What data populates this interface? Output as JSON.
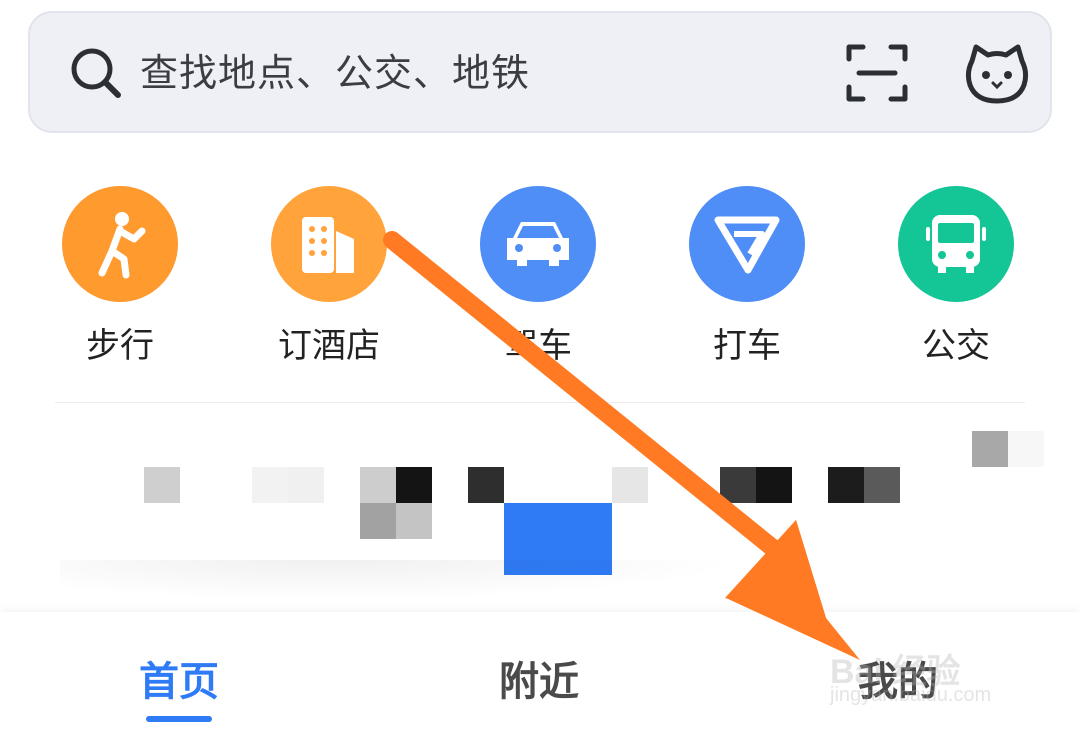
{
  "search": {
    "placeholder": "查找地点、公交、地铁",
    "icons": [
      "search-icon",
      "scan-icon",
      "mascot-icon"
    ]
  },
  "shortcuts": [
    {
      "label": "步行",
      "icon": "walking-person-icon",
      "color": "#ff9a2e"
    },
    {
      "label": "订酒店",
      "icon": "hotel-building-icon",
      "color": "#ffa33a"
    },
    {
      "label": "驾车",
      "icon": "car-icon",
      "color": "#4f8df7"
    },
    {
      "label": "打车",
      "icon": "taxi-logo-icon",
      "color": "#4f8df7"
    },
    {
      "label": "公交",
      "icon": "bus-icon",
      "color": "#14c596"
    }
  ],
  "tabs": [
    {
      "label": "首页",
      "active": true
    },
    {
      "label": "附近",
      "active": false
    },
    {
      "label": "我的",
      "active": false
    }
  ],
  "watermark": {
    "text": "Bai 经验",
    "sub": "jingyan.baidu.com"
  },
  "colors": {
    "accent": "#2f7bf6",
    "arrow": "#ff7a22"
  }
}
